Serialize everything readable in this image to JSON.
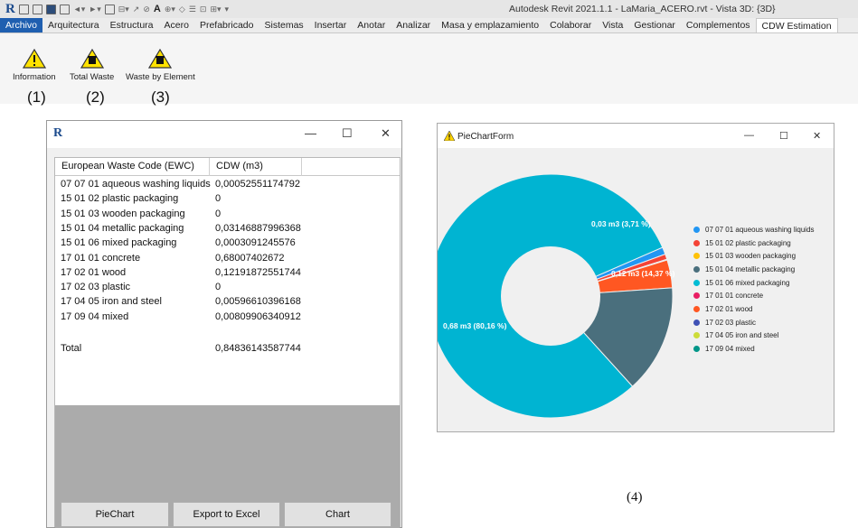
{
  "window": {
    "title": "Autodesk Revit 2021.1.1 - LaMaria_ACERO.rvt - Vista 3D: {3D}"
  },
  "ribbon": {
    "tabs": [
      "Archivo",
      "Arquitectura",
      "Estructura",
      "Acero",
      "Prefabricado",
      "Sistemas",
      "Insertar",
      "Anotar",
      "Analizar",
      "Masa y emplazamiento",
      "Colaborar",
      "Vista",
      "Gestionar",
      "Complementos",
      "CDW Estimation"
    ],
    "active_tab": "CDW Estimation",
    "buttons": [
      {
        "label": "Information",
        "number": "(1)"
      },
      {
        "label": "Total Waste",
        "number": "(2)"
      },
      {
        "label": "Waste by Element",
        "number": "(3)"
      }
    ]
  },
  "table_dialog": {
    "columns": [
      "European Waste Code (EWC)",
      "CDW (m3)"
    ],
    "rows": [
      [
        "07 07 01 aqueous washing liquids",
        "0,00052551174792"
      ],
      [
        "15 01 02 plastic packaging",
        "0"
      ],
      [
        "15 01 03 wooden packaging",
        "0"
      ],
      [
        "15 01 04 metallic packaging",
        "0,03146887996368"
      ],
      [
        "15 01 06 mixed packaging",
        "0,0003091245576"
      ],
      [
        "17 01 01 concrete",
        "0,68007402672"
      ],
      [
        "17 02 01 wood",
        "0,12191872551744"
      ],
      [
        "17 02 03 plastic",
        "0"
      ],
      [
        "17 04 05 iron and steel",
        "0,00596610396168"
      ],
      [
        "17 09 04 mixed",
        "0,00809906340912"
      ]
    ],
    "total_label": "Total",
    "total_value": "0,84836143587744",
    "buttons": [
      "PieChart",
      "Export to Excel",
      "Chart"
    ]
  },
  "pie_form": {
    "title": "PieChartForm",
    "slice_labels": [
      "0,03 m3 (3,71 %)",
      "0,12 m3 (14,37 %)",
      "0,68 m3 (80,16 %)"
    ]
  },
  "chart_data": {
    "type": "pie",
    "donut": true,
    "title": "",
    "legend_position": "right",
    "categories": [
      "07 07 01 aqueous washing liquids",
      "15 01 02 plastic packaging",
      "15 01 03 wooden packaging",
      "15 01 04 metallic packaging",
      "15 01 06 mixed packaging",
      "17 01 01 concrete",
      "17 02 01 wood",
      "17 02 03 plastic",
      "17 04 05 iron and steel",
      "17 09 04 mixed"
    ],
    "values": [
      0.00052551174792,
      0,
      0,
      0.03146887996368,
      0.0003091245576,
      0.68007402672,
      0.12191872551744,
      0,
      0.00596610396168,
      0.00809906340912
    ],
    "colors": [
      "#2196f3",
      "#f44336",
      "#ffc107",
      "#4a6f7d",
      "#00bcd4",
      "#e91e63",
      "#ff5722",
      "#3f51b5",
      "#cddc39",
      "#009688"
    ],
    "slice_colors": {
      "17 01 01 concrete": "#00b4d2",
      "17 02 01 wood": "#4a6f7d",
      "15 01 04 metallic packaging": "#ff5722",
      "17 09 04 mixed": "#2196f3",
      "17 04 05 iron and steel": "#f44336"
    }
  },
  "caption": "(4)"
}
